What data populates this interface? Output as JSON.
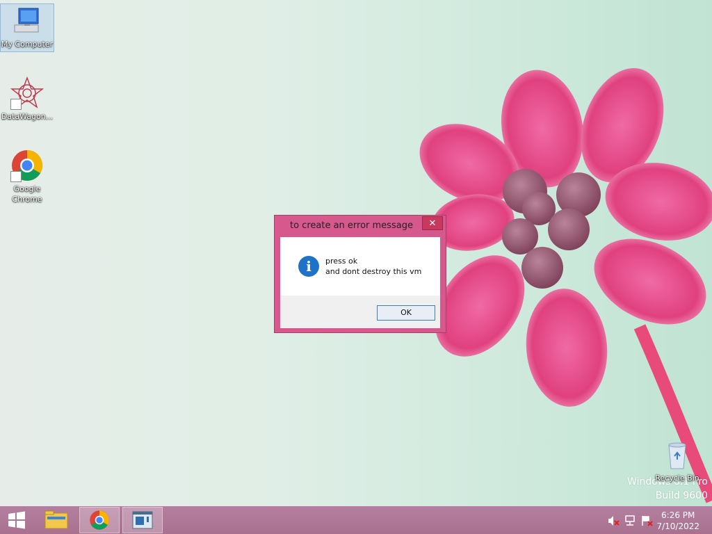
{
  "desktop": {
    "icons": [
      {
        "label": "My Computer",
        "icon": "computer-icon"
      },
      {
        "label": "DataWagon...",
        "icon": "datawagon-icon"
      },
      {
        "label": "Google Chrome",
        "icon": "chrome-icon"
      },
      {
        "label": "Recycle Bin",
        "icon": "recycle-bin-icon"
      }
    ],
    "watermark": {
      "line1": "Windows 8.1 Pro",
      "line2": "Build 9600"
    }
  },
  "dialog": {
    "title": "to create an error message",
    "close_glyph": "✕",
    "icon": "info-icon",
    "message_line1": "press ok",
    "message_line2": "and dont destroy this vm",
    "ok_label": "OK"
  },
  "taskbar": {
    "items": [
      {
        "name": "start-button",
        "icon": "windows-logo-icon"
      },
      {
        "name": "file-explorer",
        "icon": "folder-icon"
      },
      {
        "name": "chrome",
        "icon": "chrome-icon"
      },
      {
        "name": "dialog-app",
        "icon": "window-app-icon"
      }
    ],
    "tray": {
      "icons": [
        "speaker-muted-icon",
        "network-icon",
        "action-center-flag-icon"
      ],
      "time": "6:26 PM",
      "date": "7/10/2022"
    }
  },
  "colors": {
    "accent": "#d7588c",
    "close": "#c7395e",
    "taskbar": "#b07a9a",
    "info": "#1e73c8"
  }
}
